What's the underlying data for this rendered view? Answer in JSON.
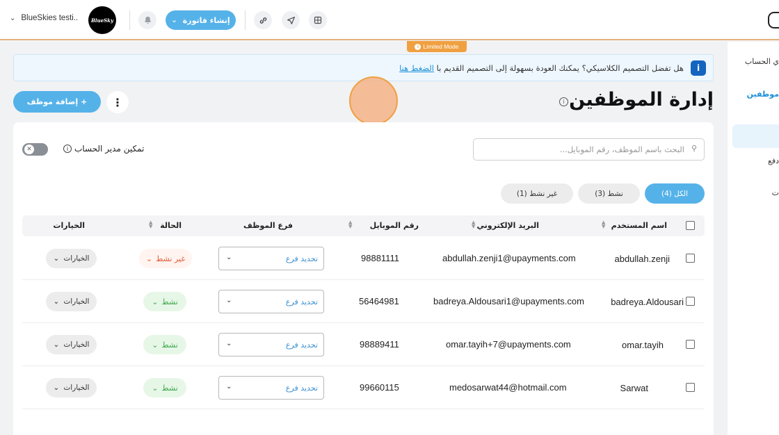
{
  "topbar": {
    "account_name": "BlueSkies testi..",
    "logo_text": "BlueSky",
    "create_invoice_label": "إنشاء فاتورة",
    "limited_mode": "Limited Mode"
  },
  "sidenav": {
    "items": [
      "ي الحساب",
      "موظفين",
      "دفع",
      "ت"
    ]
  },
  "banner": {
    "text": "هل تفضل التصميم الكلاسيكي؟ يمكنك العودة بسهولة إلى التصميم القديم با",
    "link_text": "الضغط هنا"
  },
  "page": {
    "title": "إدارة الموظفين",
    "add_employee_label": "+ إضافة موظف"
  },
  "filters": {
    "search_placeholder": "البحث باسم الموظف، رقم الموبايل...",
    "toggle_label": "تمكين مدير الحساب",
    "toggle_on": false,
    "tabs": [
      {
        "label": "الكل (4)",
        "active": true
      },
      {
        "label": "نشط (3)",
        "active": false
      },
      {
        "label": "غير نشط (1)",
        "active": false
      }
    ]
  },
  "table": {
    "headers": {
      "username": "اسم المستخدم",
      "email": "البريد الإلكتروني",
      "mobile": "رقم الموبايل",
      "branch": "فرع الموظف",
      "status": "الحالة",
      "options": "الخيارات"
    },
    "branch_placeholder": "تحديد فرع",
    "options_label": "الخيارات",
    "rows": [
      {
        "username": "abdullah.zenji",
        "email": "abdullah.zenji1@upayments.com",
        "mobile": "98881111",
        "status": "غير نشط",
        "active": false
      },
      {
        "username": "badreya.Aldousari",
        "email": "badreya.Aldousari1@upayments.com",
        "mobile": "56464981",
        "status": "نشط",
        "active": true
      },
      {
        "username": "omar.tayih",
        "email": "omar.tayih+7@upayments.com",
        "mobile": "98889411",
        "status": "نشط",
        "active": true
      },
      {
        "username": "Sarwat",
        "email": "medosarwat44@hotmail.com",
        "mobile": "99660115",
        "status": "نشط",
        "active": true
      }
    ]
  },
  "colors": {
    "accent": "#55b2e9",
    "limited": "#f0a040",
    "active_status": "#3aa84a",
    "inactive_status": "#e05b3a"
  }
}
